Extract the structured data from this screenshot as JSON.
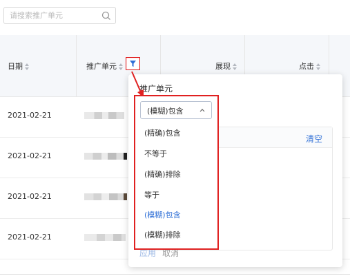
{
  "search": {
    "placeholder": "请搜索推广单元"
  },
  "table": {
    "columns": [
      "日期",
      "推广单元",
      "展现",
      "点击"
    ],
    "rows": [
      {
        "date": "2021-02-21"
      },
      {
        "date": "2021-02-21"
      },
      {
        "date": "2021-02-21"
      },
      {
        "date": "2021-02-21"
      }
    ]
  },
  "filter_popover": {
    "title": "推广单元",
    "selected_value": "(模糊)包含",
    "options": [
      "(精确)包含",
      "不等于",
      "(精确)排除",
      "等于",
      "(模糊)包含",
      "(模糊)排除"
    ],
    "clear_label": "清空",
    "apply_label": "应用",
    "cancel_label": "取消"
  },
  "colors": {
    "accent": "#2f6fd6",
    "highlight": "#e02020",
    "header_bg": "#f5f7fa"
  },
  "icons": {
    "search": "search-icon",
    "filter": "filter-icon",
    "sort": "sort-icon",
    "chevron": "chevron-up-icon"
  }
}
